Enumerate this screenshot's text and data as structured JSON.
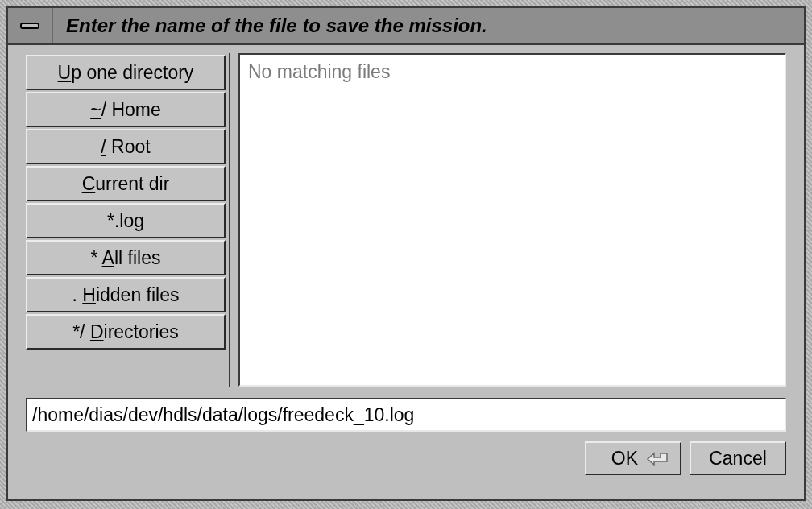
{
  "window": {
    "title": "Enter the name of the file to save the mission."
  },
  "shortcuts": [
    {
      "label_parts": [
        {
          "text": "U",
          "underlined": true
        },
        {
          "text": "p one directory",
          "underlined": false
        }
      ]
    },
    {
      "label_parts": [
        {
          "text": "~",
          "underlined": true
        },
        {
          "text": "/ Home",
          "underlined": false
        }
      ]
    },
    {
      "label_parts": [
        {
          "text": "/",
          "underlined": true
        },
        {
          "text": " Root",
          "underlined": false
        }
      ]
    },
    {
      "label_parts": [
        {
          "text": "C",
          "underlined": true
        },
        {
          "text": "urrent dir",
          "underlined": false
        }
      ]
    },
    {
      "label_parts": [
        {
          "text": "*.log",
          "underlined": false
        }
      ]
    },
    {
      "label_parts": [
        {
          "text": "* ",
          "underlined": false
        },
        {
          "text": "A",
          "underlined": true
        },
        {
          "text": "ll files",
          "underlined": false
        }
      ]
    },
    {
      "label_parts": [
        {
          "text": ". ",
          "underlined": false
        },
        {
          "text": "H",
          "underlined": true
        },
        {
          "text": "idden files",
          "underlined": false
        }
      ]
    },
    {
      "label_parts": [
        {
          "text": "*/ ",
          "underlined": false
        },
        {
          "text": "D",
          "underlined": true
        },
        {
          "text": "irectories",
          "underlined": false
        }
      ]
    }
  ],
  "file_list": {
    "message": "No matching files"
  },
  "filename": {
    "value": "/home/dias/dev/hdls/data/logs/freedeck_10.log"
  },
  "buttons": [
    {
      "label": "OK",
      "kind": "default"
    },
    {
      "label": "Cancel",
      "kind": "plain"
    }
  ]
}
